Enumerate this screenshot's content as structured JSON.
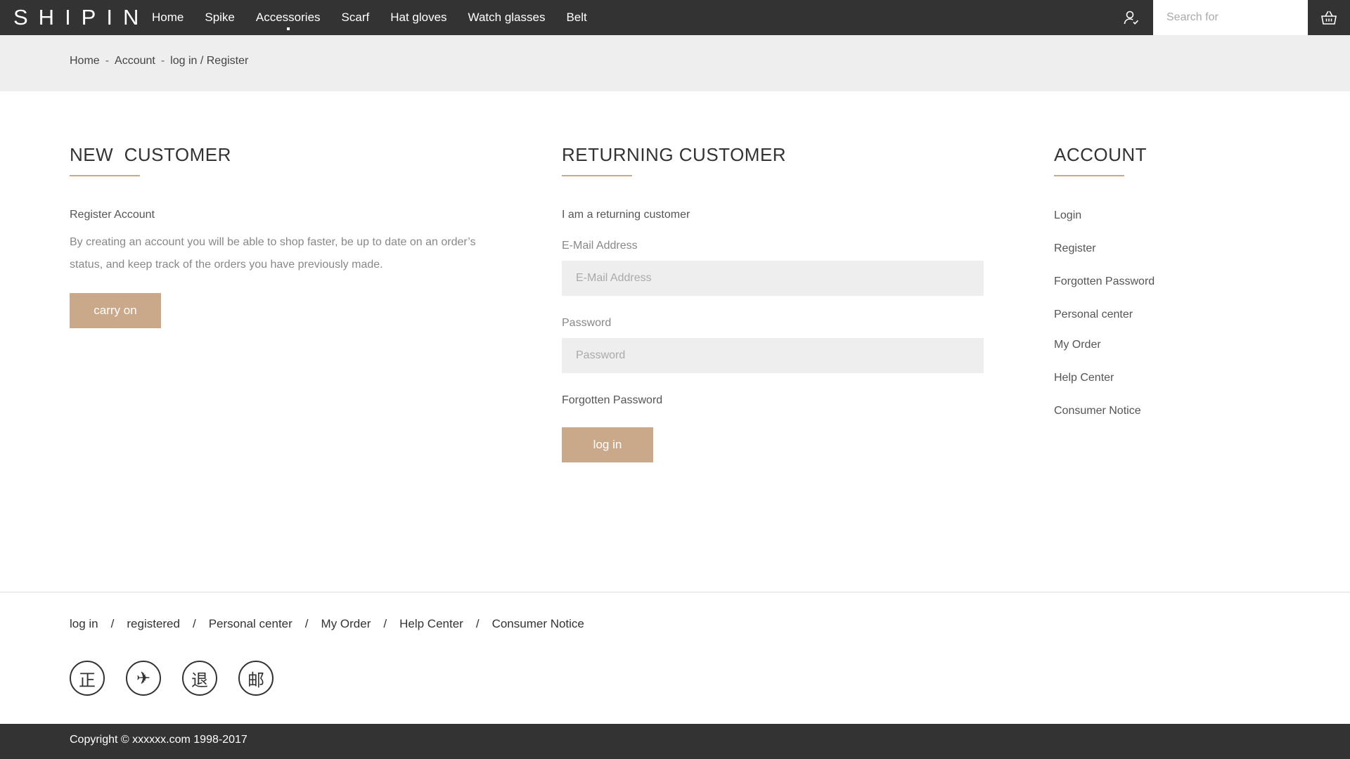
{
  "header": {
    "logo": "SHIPIN",
    "nav": [
      {
        "label": "Home"
      },
      {
        "label": "Spike"
      },
      {
        "label": "Accessories"
      },
      {
        "label": "Scarf"
      },
      {
        "label": "Hat gloves"
      },
      {
        "label": "Watch glasses"
      },
      {
        "label": "Belt"
      }
    ],
    "active_nav": "Accessories",
    "search_placeholder": "Search for",
    "icons": {
      "user": "user-icon",
      "cart": "basket-icon"
    }
  },
  "breadcrumb": {
    "items": [
      "Home",
      "Account",
      "log in / Register"
    ],
    "separator": "-"
  },
  "new_customer": {
    "title": "NEW  CUSTOMER",
    "subtitle": "Register Account",
    "description_line1": "By creating an account you will be able to shop faster, be up to date on an order’s",
    "description_line2": "status, and keep track of the orders you have previously made.",
    "button": "carry on"
  },
  "returning_customer": {
    "title": "RETURNING CUSTOMER",
    "subtitle": "I am a returning customer",
    "email_label": "E-Mail Address",
    "email_placeholder": "E-Mail Address",
    "password_label": "Password",
    "password_placeholder": "Password",
    "forgot": "Forgotten Password",
    "button": "log in"
  },
  "account": {
    "title": "ACCOUNT",
    "links": [
      "Login",
      "Register",
      "Forgotten Password",
      "Personal center",
      "My Order",
      "Help Center",
      "Consumer Notice"
    ]
  },
  "footer": {
    "links": [
      "log in",
      "registered",
      "Personal center",
      "My Order",
      "Help Center",
      "Consumer Notice"
    ],
    "separator": "/",
    "badges": [
      "正",
      "✈",
      "退",
      "邮"
    ],
    "copyright": "Copyright © xxxxxx.com 1998-2017"
  },
  "colors": {
    "header_bg": "#333333",
    "accent": "#c9a98a",
    "crumb_bg": "#eeeeee",
    "input_bg": "#eeeeee"
  }
}
